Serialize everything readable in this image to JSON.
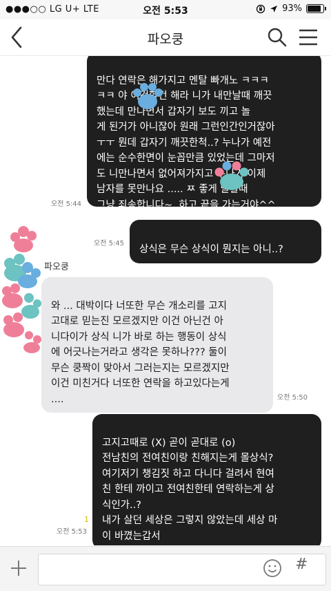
{
  "status": {
    "carrier": "●●●○○ LG U+  LTE",
    "time": "오전 5:53",
    "battery": "93%"
  },
  "header": {
    "title": "파오쿵"
  },
  "messages": [
    {
      "side": "right",
      "text": "만다 연락은 해가지고 멘탈 빠개노 ㅋㅋㅋ\nㅋㅋ 야 이것할건 해라 니가 내만날때 깨끗\n했는데 만나면서 갑자기 보도 끼고 놀\n게 된거가 아니잖아 원래 그런인간인거잖아\nㅜㅜ 뭔데 갑자기 깨끗한척..? 누나가 예전\n에는 순수한면이 눈꼽만큼 있었는데 그마저\n도 니만나면서 없어져가지고 누나가 이제\n남자를 못만나요 ..... ㅉ 좋게 말할때\n그냥 죄송합니다~. 하고 끝을 가는거야^^",
      "time": "오전 5:44"
    },
    {
      "side": "right",
      "text": "상식은 무슨 상식이 뭔지는 아니..?",
      "time": "오전 5:45"
    },
    {
      "side": "left",
      "sender": "파오쿵",
      "text": "와 ... 대박이다 너또한 무슨 개소리를 고지\n고대로 믿는진 모르겠지만 이건 아닌건 아\n니다이가 상식 니가 바로 하는 행동이 상식\n에 어긋나는거라고 생각은 못하나??? 둘이\n무슨 쿵짝이 맞아서 그러는지는 모르겠지만\n이건 미친거다 너또한 연락을 하고있다는게\n....",
      "time": "오전 5:50"
    },
    {
      "side": "right",
      "text": "고지고때로 (X) 곧이 곧대로 (o)\n전남친의 전여친이랑 친해지는게 몰상식?\n여기저기 챙김짓 하고 다니다 걸려서 현여\n친 한테 까이고 전여친한테 연락하는게 상\n식인가..?\n내가 살던 세상은 그렇지 않았는데 세상 마\n이 바꼈는갑서",
      "time": "오전 5:53",
      "unread": "1"
    }
  ],
  "colors": {
    "dark_bubble": "#1f1f1f",
    "light_bubble": "#e9e9eb",
    "paw_blue": "#6aaedf",
    "paw_teal": "#6cc3c1",
    "paw_pink": "#ef7f98"
  },
  "input": {
    "placeholder": "",
    "hash": "#"
  }
}
